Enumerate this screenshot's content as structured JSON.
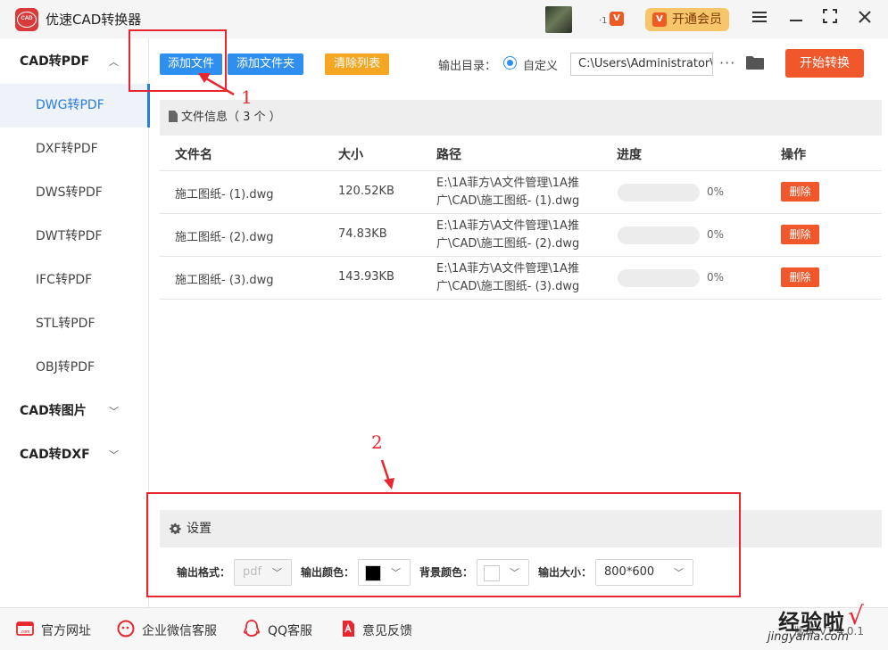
{
  "app": {
    "title": "优速CAD转换器",
    "vip_label": "开通会员",
    "vip_badge": "V"
  },
  "sidebar": {
    "groups": [
      {
        "label": "CAD转PDF",
        "expanded": true
      },
      {
        "label": "CAD转图片",
        "expanded": false
      },
      {
        "label": "CAD转DXF",
        "expanded": false
      }
    ],
    "items": [
      {
        "label": "DWG转PDF",
        "active": true
      },
      {
        "label": "DXF转PDF"
      },
      {
        "label": "DWS转PDF"
      },
      {
        "label": "DWT转PDF"
      },
      {
        "label": "IFC转PDF"
      },
      {
        "label": "STL转PDF"
      },
      {
        "label": "OBJ转PDF"
      }
    ]
  },
  "toolbar": {
    "add_file": "添加文件",
    "add_folder": "添加文件夹",
    "clear_list": "清除列表",
    "output_dir_label": "输出目录：",
    "custom_label": "自定义",
    "output_path": "C:\\Users\\Administrator\\",
    "more": "···",
    "start": "开始转换"
  },
  "file_info": {
    "title": "文件信息（ 3 个 ）",
    "columns": {
      "name": "文件名",
      "size": "大小",
      "path": "路径",
      "progress": "进度",
      "action": "操作"
    },
    "files": [
      {
        "name": "施工图纸- (1).dwg",
        "size": "120.52KB",
        "path_line1": "E:\\1A菲方\\A文件管理\\1A推",
        "path_line2": "广\\CAD\\施工图纸- (1).dwg",
        "progress": 0,
        "progress_text": "0%",
        "action": "删除"
      },
      {
        "name": "施工图纸- (2).dwg",
        "size": "74.83KB",
        "path_line1": "E:\\1A菲方\\A文件管理\\1A推",
        "path_line2": "广\\CAD\\施工图纸- (2).dwg",
        "progress": 0,
        "progress_text": "0%",
        "action": "删除"
      },
      {
        "name": "施工图纸- (3).dwg",
        "size": "143.93KB",
        "path_line1": "E:\\1A菲方\\A文件管理\\1A推",
        "path_line2": "广\\CAD\\施工图纸- (3).dwg",
        "progress": 0,
        "progress_text": "0%",
        "action": "删除"
      }
    ]
  },
  "settings": {
    "title": "设置",
    "format_label": "输出格式：",
    "format_value": "pdf",
    "color_label": "输出颜色：",
    "color_value": "#000000",
    "bg_label": "背景颜色：",
    "bg_value": "#ffffff",
    "size_label": "输出大小：",
    "size_value": "800*600"
  },
  "annotations": {
    "step1": "1",
    "step2": "2",
    "color": "#e8262f"
  },
  "footer": {
    "website": "官方网址",
    "wechat": "企业微信客服",
    "qq": "QQ客服",
    "feedback": "意见反馈",
    "version": "版本 V1.4.0.1"
  },
  "watermark": {
    "main": "经验啦",
    "check": "√",
    "sub": "jingyanla.com"
  },
  "colors": {
    "accent_blue": "#2f8ff0",
    "start_orange": "#f0572a",
    "clear_orange": "#f5a623",
    "vip_gold": "#f7c56a"
  }
}
